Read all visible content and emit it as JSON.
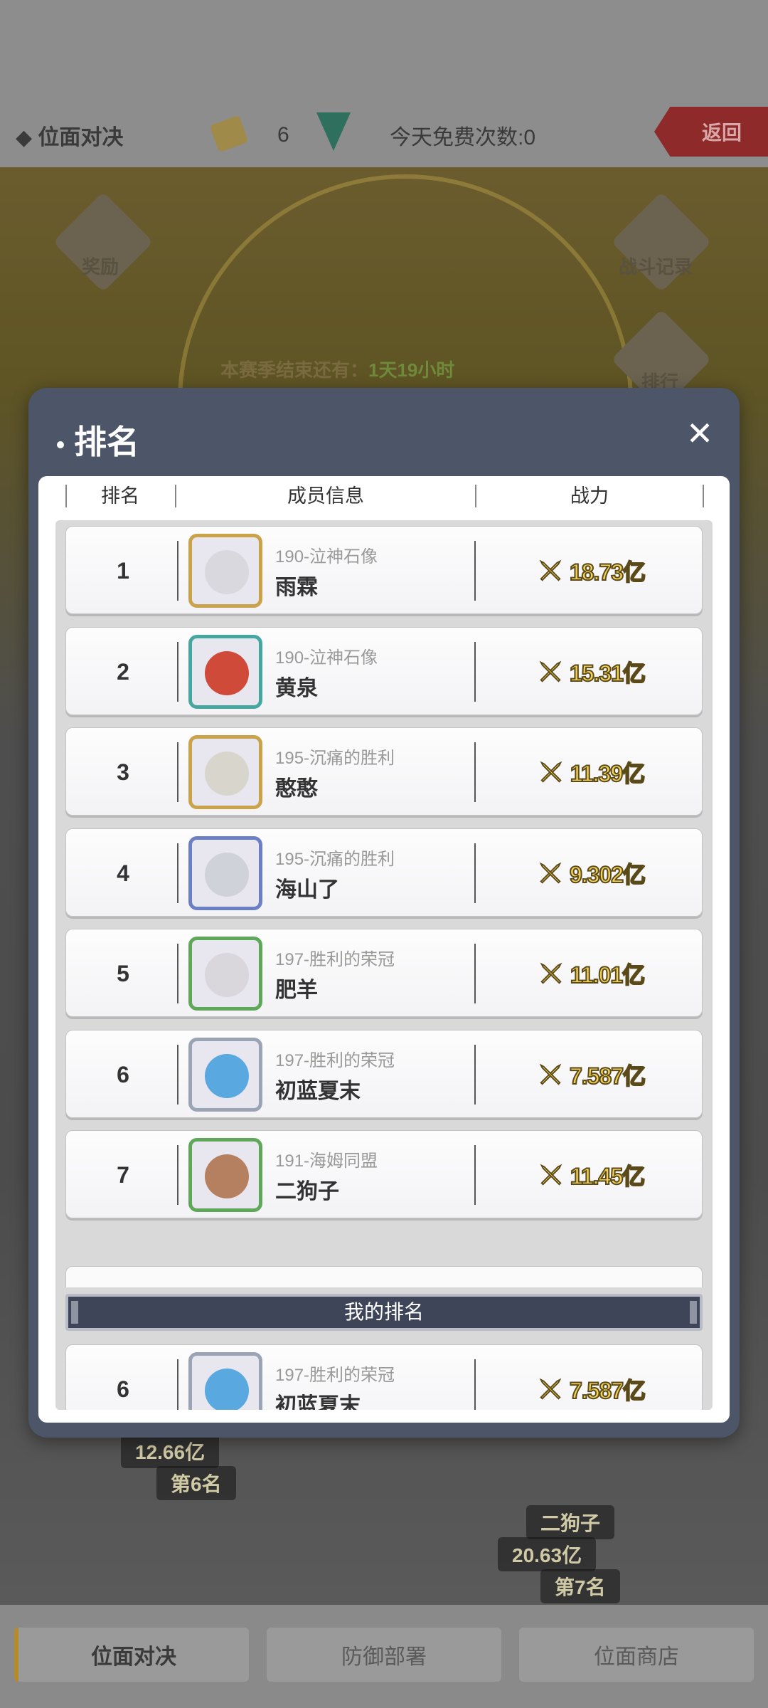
{
  "topbar": {
    "title": "◆ 位面对决",
    "ticket_count": "6",
    "free_count": "今天免费次数:0",
    "back_label": "返回"
  },
  "background": {
    "season_label": "本赛季结束还有：",
    "season_time": "1天19小时",
    "reward_label": "奖励",
    "battle_record_label": "战斗记录",
    "ranking_label": "排行",
    "bg_player1_power": "12.66亿",
    "bg_player1_rank": "第6名",
    "bg_player2_name": "二狗子",
    "bg_player2_power": "20.63亿",
    "bg_player2_rank": "第7名"
  },
  "bottom_nav": {
    "items": [
      {
        "label": "位面对决",
        "active": true
      },
      {
        "label": "防御部署",
        "active": false
      },
      {
        "label": "位面商店",
        "active": false
      }
    ]
  },
  "modal": {
    "title": "排名",
    "close_icon": "close-icon",
    "headers": {
      "rank": "排名",
      "member": "成员信息",
      "power": "战力"
    },
    "rows": [
      {
        "rank": "1",
        "server": "190-泣神石像",
        "name": "雨霖",
        "power": "18.73亿",
        "frame": "#c9a24a",
        "face": "#d8d8de"
      },
      {
        "rank": "2",
        "server": "190-泣神石像",
        "name": "黄泉",
        "power": "15.31亿",
        "frame": "#45a7a0",
        "face": "#d04a3a"
      },
      {
        "rank": "3",
        "server": "195-沉痛的胜利",
        "name": "憨憨",
        "power": "11.39亿",
        "frame": "#c9a24a",
        "face": "#d8d6cc"
      },
      {
        "rank": "4",
        "server": "195-沉痛的胜利",
        "name": "海山了",
        "power": "9.302亿",
        "frame": "#6b7fc4",
        "face": "#cfd2d8"
      },
      {
        "rank": "5",
        "server": "197-胜利的荣冠",
        "name": "肥羊",
        "power": "11.01亿",
        "frame": "#5fa85a",
        "face": "#d9d6dc"
      },
      {
        "rank": "6",
        "server": "197-胜利的荣冠",
        "name": "初蓝夏末",
        "power": "7.587亿",
        "frame": "#9aa4b4",
        "face": "#5aa8e0"
      },
      {
        "rank": "7",
        "server": "191-海姆同盟",
        "name": "二狗子",
        "power": "11.45亿",
        "frame": "#5fa85a",
        "face": "#b58060"
      }
    ],
    "my_rank_label": "我的排名",
    "my_rank": {
      "rank": "6",
      "server": "197-胜利的荣冠",
      "name": "初蓝夏末",
      "power": "7.587亿",
      "frame": "#9aa4b4",
      "face": "#5aa8e0"
    }
  }
}
